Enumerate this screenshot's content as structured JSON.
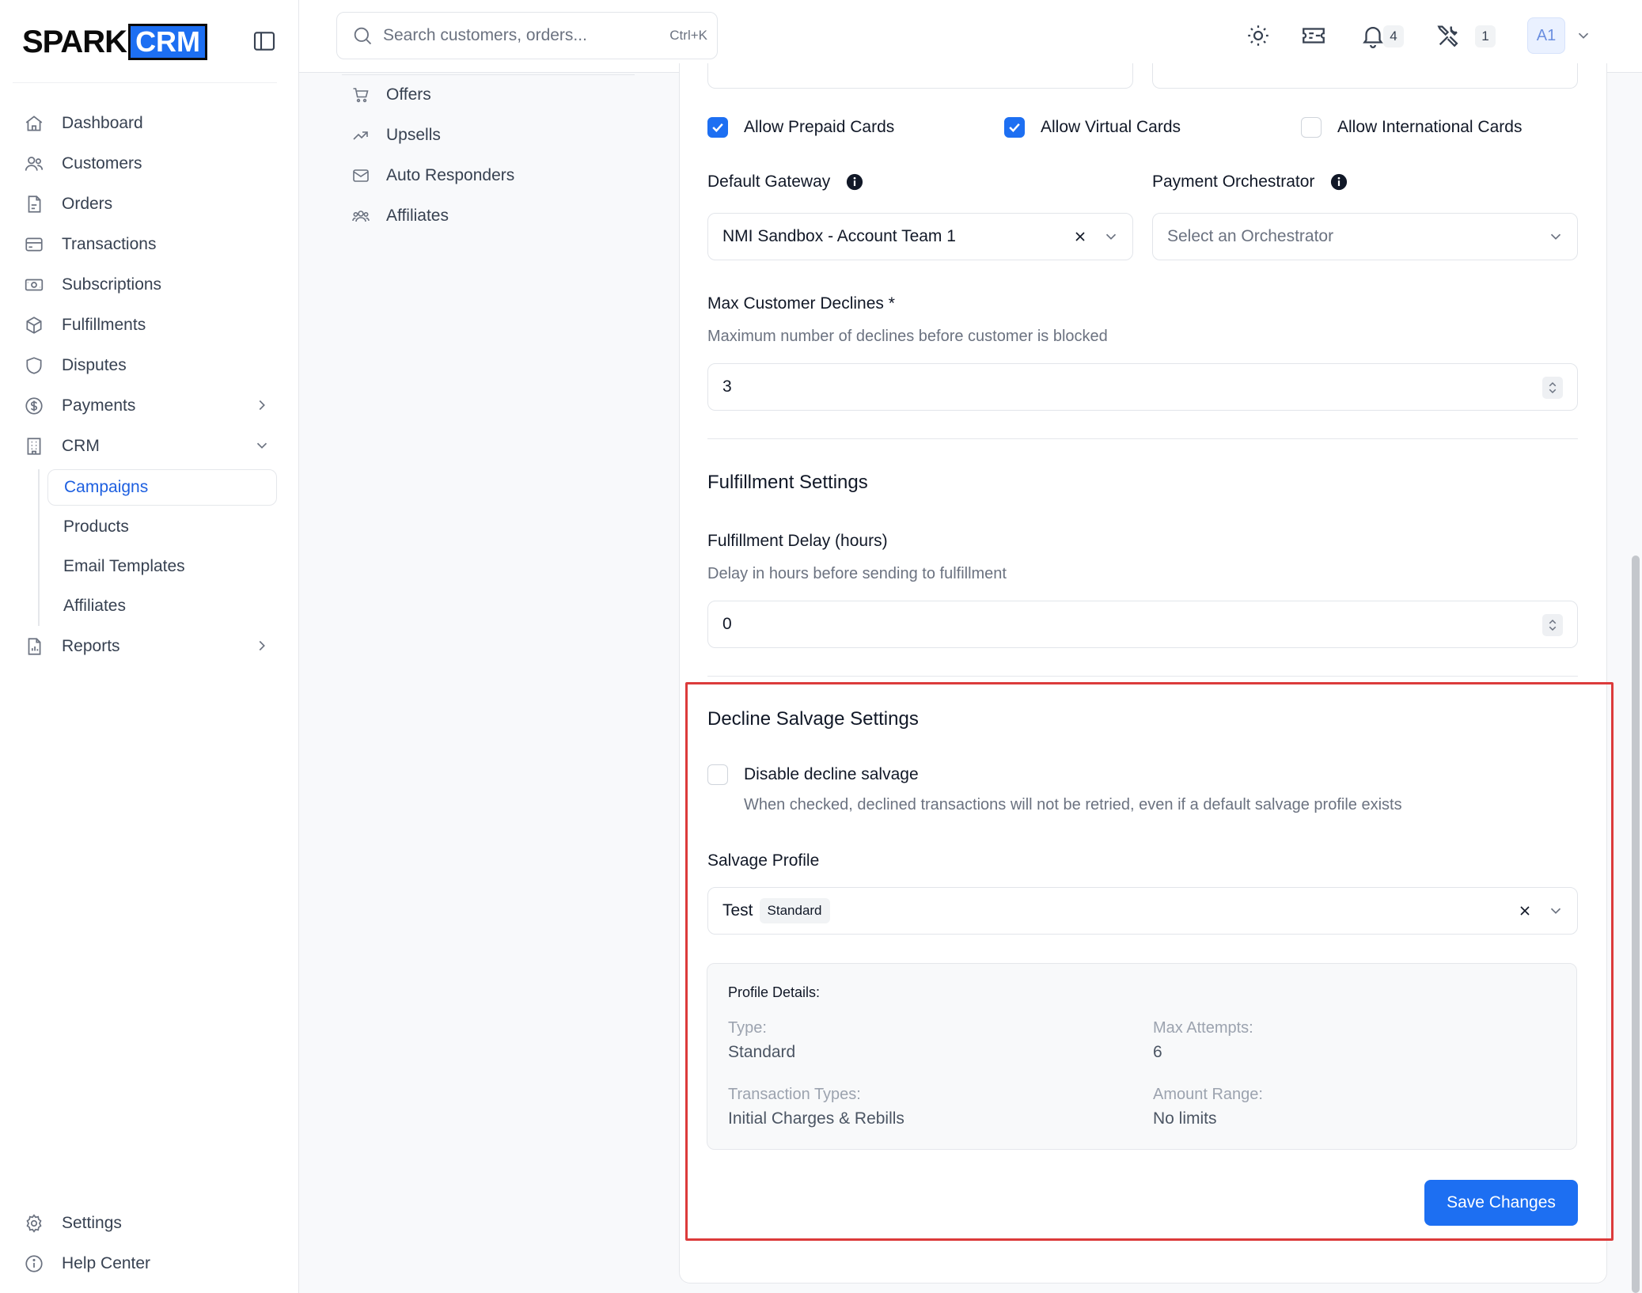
{
  "brand": {
    "part1": "SPARK",
    "part2": "CRM"
  },
  "sidebar": {
    "items": [
      {
        "label": "Dashboard",
        "icon": "home-icon"
      },
      {
        "label": "Customers",
        "icon": "users-icon"
      },
      {
        "label": "Orders",
        "icon": "file-icon"
      },
      {
        "label": "Transactions",
        "icon": "credit-card-icon"
      },
      {
        "label": "Subscriptions",
        "icon": "money-icon"
      },
      {
        "label": "Fulfillments",
        "icon": "box-icon"
      },
      {
        "label": "Disputes",
        "icon": "shield-icon"
      },
      {
        "label": "Payments",
        "icon": "dollar-icon"
      },
      {
        "label": "CRM",
        "icon": "building-icon"
      }
    ],
    "crm_sub": [
      "Campaigns",
      "Products",
      "Email Templates",
      "Affiliates"
    ],
    "reports": "Reports",
    "bottom": [
      "Settings",
      "Help Center"
    ]
  },
  "topbar": {
    "search_placeholder": "Search customers, orders...",
    "search_shortcut": "Ctrl+K",
    "notifications_count": "4",
    "tools_count": "1",
    "avatar": "A1"
  },
  "secnav": [
    "Offers",
    "Upsells",
    "Auto Responders",
    "Affiliates"
  ],
  "cards": {
    "prepaid": {
      "label": "Allow Prepaid Cards",
      "checked": true
    },
    "virtual": {
      "label": "Allow Virtual Cards",
      "checked": true
    },
    "international": {
      "label": "Allow International Cards",
      "checked": false
    }
  },
  "gateway": {
    "label": "Default Gateway",
    "value": "NMI Sandbox - Account Team 1"
  },
  "orchestrator": {
    "label": "Payment Orchestrator",
    "placeholder": "Select an Orchestrator"
  },
  "declines": {
    "label": "Max Customer Declines *",
    "help": "Maximum number of declines before customer is blocked",
    "value": "3"
  },
  "fulfillment": {
    "title": "Fulfillment Settings",
    "delay_label": "Fulfillment Delay (hours)",
    "delay_help": "Delay in hours before sending to fulfillment",
    "delay_value": "0"
  },
  "salvage": {
    "title": "Decline Salvage Settings",
    "disable_label": "Disable decline salvage",
    "disable_help": "When checked, declined transactions will not be retried, even if a default salvage profile exists",
    "disable_checked": false,
    "profile_label": "Salvage Profile",
    "profile_value": "Test",
    "profile_tag": "Standard",
    "details_title": "Profile Details:",
    "type_key": "Type:",
    "type_val": "Standard",
    "max_key": "Max Attempts:",
    "max_val": "6",
    "tx_key": "Transaction Types:",
    "tx_val": "Initial Charges & Rebills",
    "amount_key": "Amount Range:",
    "amount_val": "No limits"
  },
  "save_label": "Save Changes",
  "colors": {
    "accent": "#1d6ff2",
    "highlight": "#dc3b3b"
  }
}
